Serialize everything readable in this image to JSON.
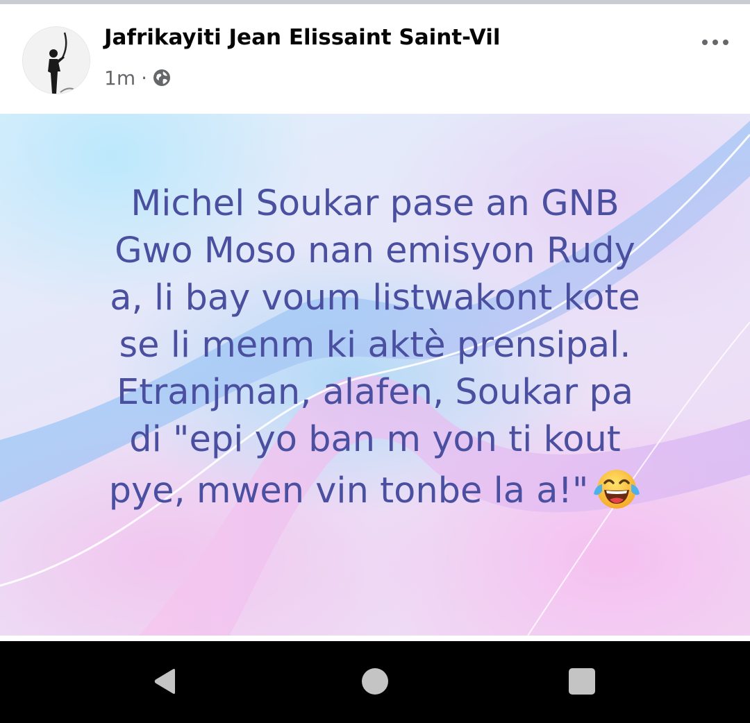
{
  "post": {
    "author": "Jafrikayiti Jean Elissaint Saint-Vil",
    "time": "1m",
    "separator": "·",
    "privacy_icon": "globe-icon",
    "more_icon": "more-options-icon",
    "text_lines": [
      "Michel Soukar pase an GNB",
      "Gwo Moso nan emisyon Rudy",
      "a, li bay voum listwakont kote",
      "se li menm ki aktè prensipal.",
      "Etranjman, alafen, Soukar pa",
      "di \"epi yo ban m yon ti kout",
      "pye, mwen vin tonbe la a!\""
    ],
    "emoji": "face-with-tears-of-joy-emoji",
    "text_color": "#4a4fa0"
  },
  "system_nav": {
    "back_icon": "triangle-back-icon",
    "home_icon": "circle-home-icon",
    "recents_icon": "square-recents-icon"
  },
  "colors": {
    "name": "#050505",
    "meta": "#65676b",
    "nav_bar": "#000000",
    "nav_icons": "#c4c4c4"
  }
}
